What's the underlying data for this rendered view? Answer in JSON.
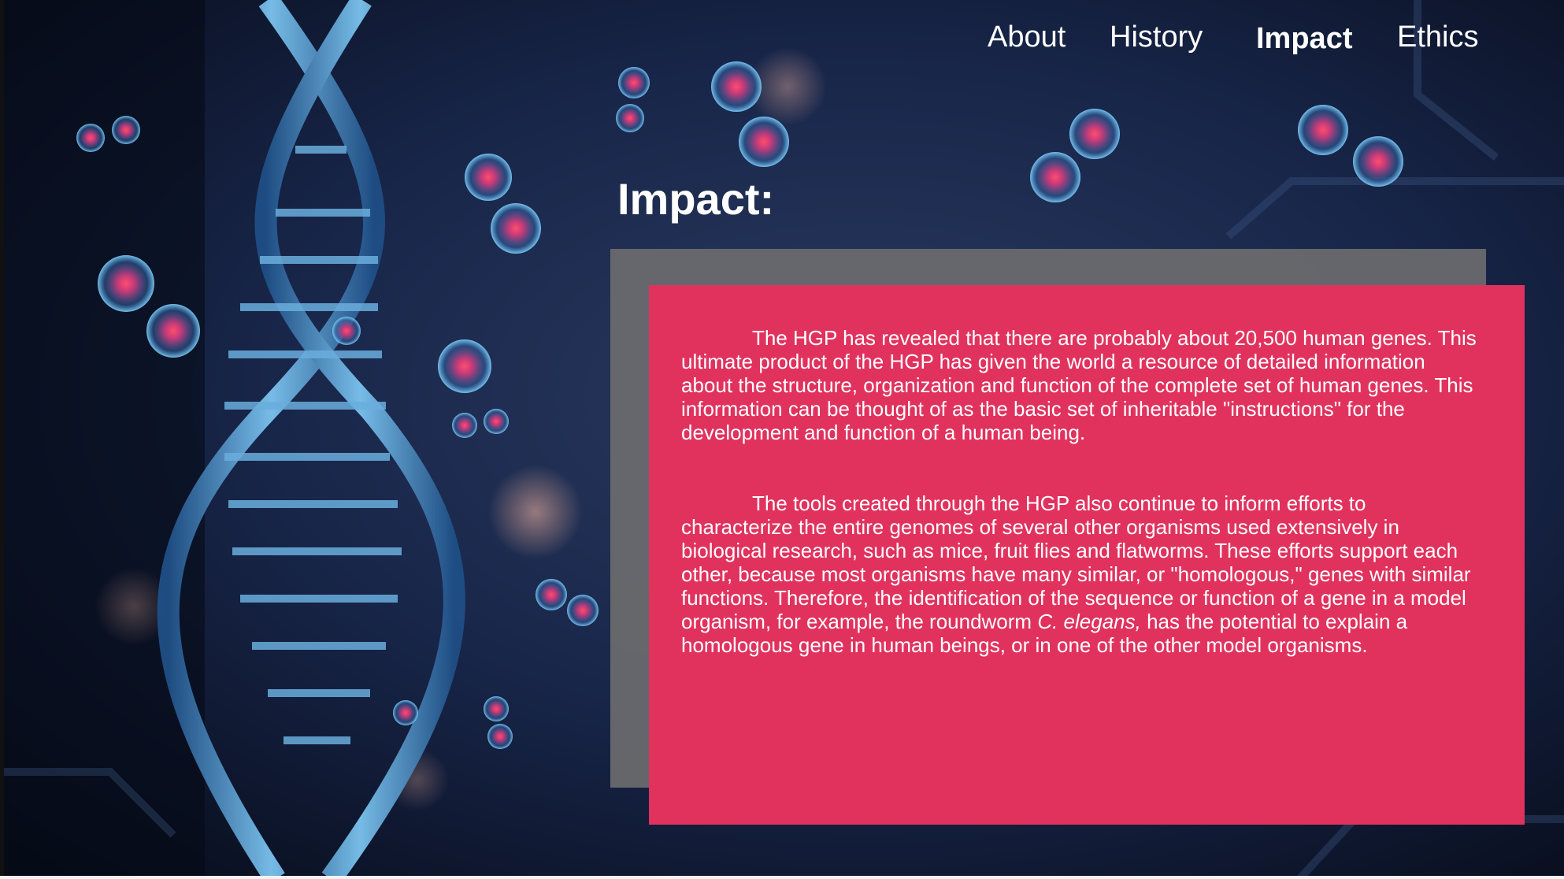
{
  "nav": {
    "items": [
      "About",
      "History",
      "Impact",
      "Ethics"
    ],
    "active": "Impact"
  },
  "main": {
    "title": "Impact:",
    "paragraph1": "The HGP has revealed that there are probably about 20,500 human genes. This ultimate product of the HGP has given the world a resource of detailed information about the structure, organization and function of the complete set of human genes. This information can be thought of as the basic set of inheritable \"instructions\" for the development and function of a human being.",
    "paragraph2_before": "The tools created through the HGP also continue to inform efforts to characterize the entire genomes of several other organisms used extensively in biological research, such as mice, fruit flies and flatworms. These efforts support each other, because most organisms have many similar, or \"homologous,\" genes with similar functions. Therefore, the identification of the sequence or function of a gene in a model organism, for example, the roundworm ",
    "paragraph2_italic": "C. elegans,",
    "paragraph2_after": " has the potential to explain a homologous gene in human beings, or in one of the other model organisms."
  },
  "colors": {
    "card": "#e1325e",
    "panel": "#6c6c6e",
    "background": "#0b1326",
    "text": "#ffffff"
  },
  "background_image": "dna-helix-with-cells"
}
